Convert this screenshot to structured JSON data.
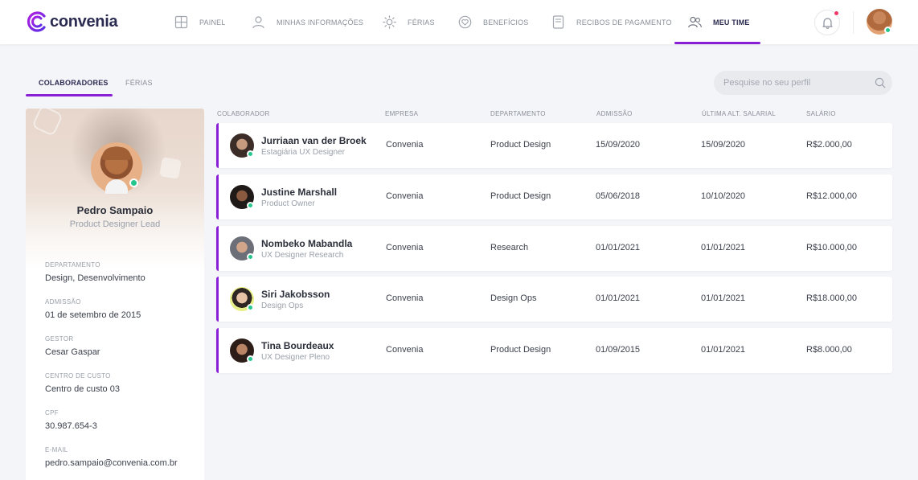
{
  "brand": {
    "name": "convenia",
    "accent": "#8a1fd6",
    "online": "#25c68c",
    "alert": "#f2386a"
  },
  "nav": [
    {
      "label": "PAINEL",
      "icon": "grid-icon"
    },
    {
      "label": "MINHAS INFORMAÇÕES",
      "icon": "user-icon"
    },
    {
      "label": "FÉRIAS",
      "icon": "sun-icon"
    },
    {
      "label": "BENEFÍCIOS",
      "icon": "heart-icon"
    },
    {
      "label": "RECIBOS DE PAGAMENTO",
      "icon": "receipt-icon"
    },
    {
      "label": "MEU TIME",
      "icon": "team-icon",
      "active": true
    }
  ],
  "tabs": [
    {
      "label": "COLABORADORES",
      "active": true
    },
    {
      "label": "FÉRIAS",
      "active": false
    }
  ],
  "search": {
    "placeholder": "Pesquise no seu perfil"
  },
  "profile": {
    "name": "Pedro Sampaio",
    "role": "Product Designer Lead",
    "fields": [
      {
        "label": "DEPARTAMENTO",
        "value": "Design, Desenvolvimento"
      },
      {
        "label": "ADMISSÃO",
        "value": "01 de setembro de 2015"
      },
      {
        "label": "GESTOR",
        "value": "Cesar Gaspar"
      },
      {
        "label": "CENTRO DE CUSTO",
        "value": "Centro de custo 03"
      },
      {
        "label": "CPF",
        "value": "30.987.654-3"
      },
      {
        "label": "E-MAIL",
        "value": "pedro.sampaio@convenia.com.br"
      }
    ]
  },
  "table": {
    "headers": [
      "COLABORADOR",
      "EMPRESA",
      "DEPARTAMENTO",
      "ADMISSÃO",
      "ÚLTIMA ALT. SALARIAL",
      "SALÁRIO"
    ],
    "rows": [
      {
        "name": "Jurriaan van der Broek",
        "role": "Estagiária UX Designer",
        "company": "Convenia",
        "department": "Product Design",
        "admission": "15/09/2020",
        "last_change": "15/09/2020",
        "salary": "R$2.000,00"
      },
      {
        "name": "Justine Marshall",
        "role": "Product Owner",
        "company": "Convenia",
        "department": "Product Design",
        "admission": "05/06/2018",
        "last_change": "10/10/2020",
        "salary": "R$12.000,00"
      },
      {
        "name": "Nombeko Mabandla",
        "role": "UX Designer Research",
        "company": "Convenia",
        "department": "Research",
        "admission": "01/01/2021",
        "last_change": "01/01/2021",
        "salary": "R$10.000,00"
      },
      {
        "name": "Siri Jakobsson",
        "role": "Design Ops",
        "company": "Convenia",
        "department": "Design Ops",
        "admission": "01/01/2021",
        "last_change": "01/01/2021",
        "salary": "R$18.000,00"
      },
      {
        "name": "Tina Bourdeaux",
        "role": "UX Designer Pleno",
        "company": "Convenia",
        "department": "Product Design",
        "admission": "01/09/2015",
        "last_change": "01/01/2021",
        "salary": "R$8.000,00"
      }
    ]
  }
}
